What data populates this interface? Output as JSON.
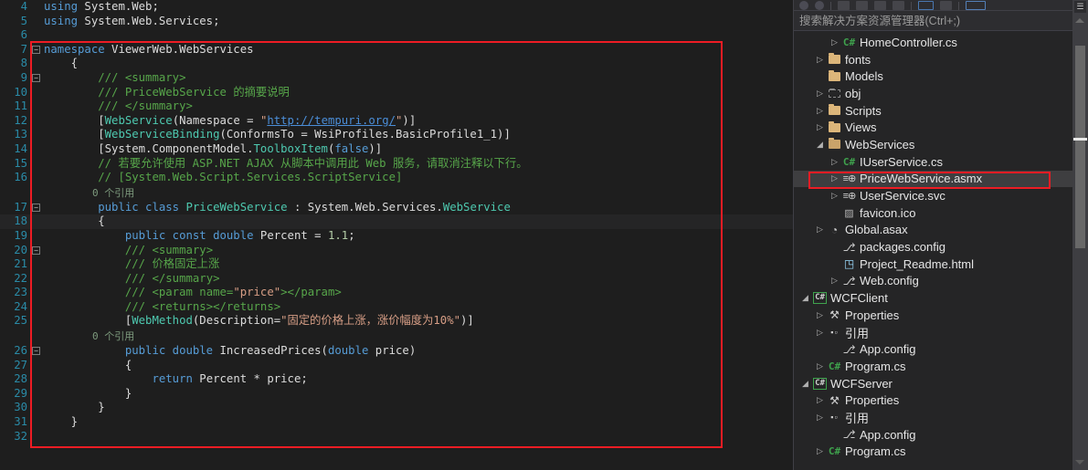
{
  "editor": {
    "language": "csharp",
    "current_line": 18,
    "first_visible_line": 4,
    "last_visible_line": 32,
    "annotation_color": "#ee1c24",
    "lines": [
      {
        "n": "4",
        "kind": "code",
        "tokens": [
          {
            "t": "using ",
            "c": "kw"
          },
          {
            "t": "System.Web",
            "c": "plain"
          },
          {
            "t": ";",
            "c": "plain"
          }
        ]
      },
      {
        "n": "5",
        "kind": "code",
        "tokens": [
          {
            "t": "using ",
            "c": "kw"
          },
          {
            "t": "System.Web.Services",
            "c": "plain"
          },
          {
            "t": ";",
            "c": "plain"
          }
        ]
      },
      {
        "n": "6",
        "kind": "code",
        "tokens": []
      },
      {
        "n": "7",
        "kind": "code",
        "fold": "minus",
        "tokens": [
          {
            "t": "namespace ",
            "c": "kw"
          },
          {
            "t": "ViewerWeb.WebServices",
            "c": "plain"
          }
        ]
      },
      {
        "n": "8",
        "kind": "code",
        "tokens": [
          {
            "t": "    {",
            "c": "plain"
          }
        ]
      },
      {
        "n": "9",
        "kind": "code",
        "fold": "minus",
        "tokens": [
          {
            "t": "        /// ",
            "c": "cmt"
          },
          {
            "t": "<summary>",
            "c": "xdoc"
          }
        ]
      },
      {
        "n": "10",
        "kind": "code",
        "tokens": [
          {
            "t": "        /// ",
            "c": "cmt"
          },
          {
            "t": "PriceWebService ",
            "c": "xdoc"
          },
          {
            "t": "的摘要说明",
            "c": "cmt"
          }
        ]
      },
      {
        "n": "11",
        "kind": "code",
        "tokens": [
          {
            "t": "        /// ",
            "c": "cmt"
          },
          {
            "t": "</summary>",
            "c": "xdoc"
          }
        ]
      },
      {
        "n": "12",
        "kind": "code",
        "tokens": [
          {
            "t": "        [",
            "c": "plain"
          },
          {
            "t": "WebService",
            "c": "type"
          },
          {
            "t": "(Namespace = ",
            "c": "plain"
          },
          {
            "t": "\"",
            "c": "str"
          },
          {
            "t": "http://tempuri.org/",
            "c": "lnk"
          },
          {
            "t": "\"",
            "c": "str"
          },
          {
            "t": ")]",
            "c": "plain"
          }
        ]
      },
      {
        "n": "13",
        "kind": "code",
        "tokens": [
          {
            "t": "        [",
            "c": "plain"
          },
          {
            "t": "WebServiceBinding",
            "c": "type"
          },
          {
            "t": "(ConformsTo = WsiProfiles.BasicProfile1_1)]",
            "c": "plain"
          }
        ]
      },
      {
        "n": "14",
        "kind": "code",
        "tokens": [
          {
            "t": "        [System.ComponentModel.",
            "c": "plain"
          },
          {
            "t": "ToolboxItem",
            "c": "type"
          },
          {
            "t": "(",
            "c": "plain"
          },
          {
            "t": "false",
            "c": "kw"
          },
          {
            "t": ")]",
            "c": "plain"
          }
        ]
      },
      {
        "n": "15",
        "kind": "code",
        "tokens": [
          {
            "t": "        // 若要允许使用 ASP.NET AJAX 从脚本中调用此 Web 服务，请取消注释以下行。",
            "c": "cmt"
          }
        ]
      },
      {
        "n": "16",
        "kind": "code",
        "tokens": [
          {
            "t": "        // [System.Web.Script.Services.ScriptService]",
            "c": "cmt"
          }
        ]
      },
      {
        "n": "",
        "kind": "codelens",
        "text": "0 个引用"
      },
      {
        "n": "17",
        "kind": "code",
        "fold": "minus",
        "tokens": [
          {
            "t": "        ",
            "c": "plain"
          },
          {
            "t": "public class ",
            "c": "kw"
          },
          {
            "t": "PriceWebService",
            "c": "type"
          },
          {
            "t": " : System.Web.Services.",
            "c": "plain"
          },
          {
            "t": "WebService",
            "c": "type"
          }
        ]
      },
      {
        "n": "18",
        "kind": "code",
        "current": true,
        "tokens": [
          {
            "t": "        {",
            "c": "plain"
          }
        ]
      },
      {
        "n": "19",
        "kind": "code",
        "tokens": [
          {
            "t": "            ",
            "c": "plain"
          },
          {
            "t": "public const double ",
            "c": "kw"
          },
          {
            "t": "Percent = ",
            "c": "plain"
          },
          {
            "t": "1.1",
            "c": "num"
          },
          {
            "t": ";",
            "c": "plain"
          }
        ]
      },
      {
        "n": "20",
        "kind": "code",
        "fold": "minus",
        "tokens": [
          {
            "t": "            /// ",
            "c": "cmt"
          },
          {
            "t": "<summary>",
            "c": "xdoc"
          }
        ]
      },
      {
        "n": "21",
        "kind": "code",
        "tokens": [
          {
            "t": "            /// ",
            "c": "cmt"
          },
          {
            "t": "价格固定上涨",
            "c": "cmt"
          }
        ]
      },
      {
        "n": "22",
        "kind": "code",
        "tokens": [
          {
            "t": "            /// ",
            "c": "cmt"
          },
          {
            "t": "</summary>",
            "c": "xdoc"
          }
        ]
      },
      {
        "n": "23",
        "kind": "code",
        "tokens": [
          {
            "t": "            /// ",
            "c": "cmt"
          },
          {
            "t": "<param name=",
            "c": "xdoc"
          },
          {
            "t": "\"price\"",
            "c": "str"
          },
          {
            "t": "></param>",
            "c": "xdoc"
          }
        ]
      },
      {
        "n": "24",
        "kind": "code",
        "tokens": [
          {
            "t": "            /// ",
            "c": "cmt"
          },
          {
            "t": "<returns></returns>",
            "c": "xdoc"
          }
        ]
      },
      {
        "n": "25",
        "kind": "code",
        "tokens": [
          {
            "t": "            [",
            "c": "plain"
          },
          {
            "t": "WebMethod",
            "c": "type"
          },
          {
            "t": "(Description=",
            "c": "plain"
          },
          {
            "t": "\"固定的价格上涨，涨价幅度为10%\"",
            "c": "str"
          },
          {
            "t": ")]",
            "c": "plain"
          }
        ]
      },
      {
        "n": "",
        "kind": "codelens",
        "text": "0 个引用"
      },
      {
        "n": "26",
        "kind": "code",
        "fold": "minus",
        "tokens": [
          {
            "t": "            ",
            "c": "plain"
          },
          {
            "t": "public double ",
            "c": "kw"
          },
          {
            "t": "IncreasedPrices(",
            "c": "plain"
          },
          {
            "t": "double ",
            "c": "kw"
          },
          {
            "t": "price)",
            "c": "plain"
          }
        ]
      },
      {
        "n": "27",
        "kind": "code",
        "tokens": [
          {
            "t": "            {",
            "c": "plain"
          }
        ]
      },
      {
        "n": "28",
        "kind": "code",
        "tokens": [
          {
            "t": "                ",
            "c": "plain"
          },
          {
            "t": "return ",
            "c": "kw"
          },
          {
            "t": "Percent * price;",
            "c": "plain"
          }
        ]
      },
      {
        "n": "29",
        "kind": "code",
        "tokens": [
          {
            "t": "            }",
            "c": "plain"
          }
        ]
      },
      {
        "n": "30",
        "kind": "code",
        "tokens": [
          {
            "t": "        }",
            "c": "plain"
          }
        ]
      },
      {
        "n": "31",
        "kind": "code",
        "tokens": [
          {
            "t": "    }",
            "c": "plain"
          }
        ]
      },
      {
        "n": "32",
        "kind": "code",
        "tokens": []
      }
    ]
  },
  "scrollbar": {
    "split_icon": "split-view-icon",
    "up_arrow": "scroll-up-arrow",
    "down_arrow": "scroll-down-arrow",
    "thumb": "scroll-thumb",
    "marker": "edit-marker"
  },
  "solution_explorer": {
    "toolbar_icons": [
      "back-icon",
      "forward-icon",
      "home-icon",
      "refresh-icon",
      "collapse-all-icon",
      "show-all-files-icon",
      "properties-icon",
      "preview-selected-items-icon",
      "sync-with-active-document-icon"
    ],
    "search": {
      "placeholder": "搜索解决方案资源管理器(Ctrl+;)",
      "value": ""
    },
    "selected_item": "PriceWebService.asmx",
    "annotation_color": "#ee1c24",
    "tree": [
      {
        "label": "HomeController.cs",
        "indent": 3,
        "twisty": "collapsed",
        "icon": "csharp-file-icon"
      },
      {
        "label": "fonts",
        "indent": 2,
        "twisty": "collapsed",
        "icon": "folder-icon"
      },
      {
        "label": "Models",
        "indent": 2,
        "twisty": "none",
        "icon": "folder-icon"
      },
      {
        "label": "obj",
        "indent": 2,
        "twisty": "collapsed",
        "icon": "folder-excluded-icon"
      },
      {
        "label": "Scripts",
        "indent": 2,
        "twisty": "collapsed",
        "icon": "folder-icon"
      },
      {
        "label": "Views",
        "indent": 2,
        "twisty": "collapsed",
        "icon": "folder-icon"
      },
      {
        "label": "WebServices",
        "indent": 2,
        "twisty": "expanded",
        "icon": "folder-open-icon"
      },
      {
        "label": "IUserService.cs",
        "indent": 3,
        "twisty": "collapsed",
        "icon": "csharp-file-icon"
      },
      {
        "label": "PriceWebService.asmx",
        "indent": 3,
        "twisty": "collapsed",
        "icon": "web-service-icon",
        "selected": true,
        "annotated": true
      },
      {
        "label": "UserService.svc",
        "indent": 3,
        "twisty": "collapsed",
        "icon": "web-service-icon"
      },
      {
        "label": "favicon.ico",
        "indent": 3,
        "twisty": "none",
        "icon": "image-file-icon"
      },
      {
        "label": "Global.asax",
        "indent": 2,
        "twisty": "collapsed",
        "icon": "asax-file-icon"
      },
      {
        "label": "packages.config",
        "indent": 3,
        "twisty": "none",
        "icon": "config-file-icon"
      },
      {
        "label": "Project_Readme.html",
        "indent": 3,
        "twisty": "none",
        "icon": "html-file-icon"
      },
      {
        "label": "Web.config",
        "indent": 3,
        "twisty": "collapsed",
        "icon": "config-file-icon"
      },
      {
        "label": "WCFClient",
        "indent": 1,
        "twisty": "expanded",
        "icon": "csharp-project-icon"
      },
      {
        "label": "Properties",
        "indent": 2,
        "twisty": "collapsed",
        "icon": "properties-icon"
      },
      {
        "label": "引用",
        "indent": 2,
        "twisty": "collapsed",
        "icon": "references-icon"
      },
      {
        "label": "App.config",
        "indent": 3,
        "twisty": "none",
        "icon": "config-file-icon"
      },
      {
        "label": "Program.cs",
        "indent": 2,
        "twisty": "collapsed",
        "icon": "csharp-file-icon"
      },
      {
        "label": "WCFServer",
        "indent": 1,
        "twisty": "expanded",
        "icon": "csharp-project-icon"
      },
      {
        "label": "Properties",
        "indent": 2,
        "twisty": "collapsed",
        "icon": "properties-icon"
      },
      {
        "label": "引用",
        "indent": 2,
        "twisty": "collapsed",
        "icon": "references-icon"
      },
      {
        "label": "App.config",
        "indent": 3,
        "twisty": "none",
        "icon": "config-file-icon"
      },
      {
        "label": "Program.cs",
        "indent": 2,
        "twisty": "collapsed",
        "icon": "csharp-file-icon"
      }
    ]
  }
}
